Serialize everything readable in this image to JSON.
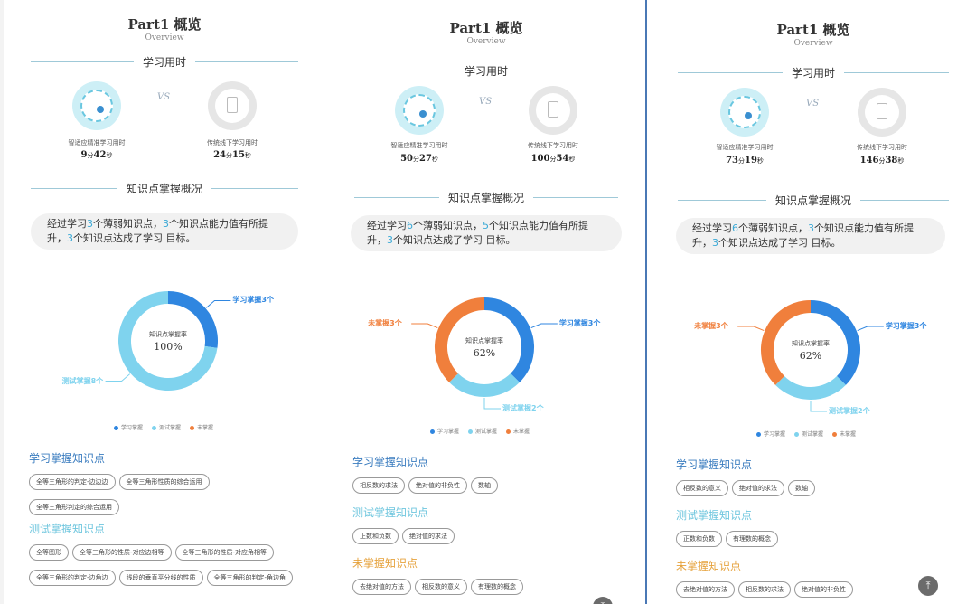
{
  "palette": {
    "blue": "#2f86e0",
    "cyan": "#7fd3ee",
    "orange": "#f07f3c",
    "tag_border": "#999999"
  },
  "legend": [
    "学习掌握",
    "测试掌握",
    "未掌握"
  ],
  "panels": [
    {
      "title": "Part1 概览",
      "subtitle": "Overview",
      "study_time_heading": "学习用时",
      "vs": "VS",
      "smart_label": "智适应精准学习用时",
      "smart_time": {
        "m": "9",
        "m_unit": "分",
        "s": "42",
        "s_unit": "秒"
      },
      "offline_label": "传统线下学习用时",
      "offline_time": {
        "m": "24",
        "m_unit": "分",
        "s": "15",
        "s_unit": "秒"
      },
      "mastery_heading": "知识点掌握概况",
      "summary": {
        "p1": "经过学习",
        "n1": "3",
        "p2": "个薄弱知识点，",
        "n2": "3",
        "p3": "个知识点能力值有所提升",
        "p4": "，",
        "n3": "3",
        "p5": "个知识点达成了学习 目标。"
      },
      "chart_data": {
        "type": "pie",
        "center_label": "知识点掌握率",
        "center_value": "100%",
        "slices": [
          {
            "name": "学习掌握",
            "label": "学习掌握3个",
            "value": 3,
            "color": "#2f86e0"
          },
          {
            "name": "测试掌握",
            "label": "测试掌握8个",
            "value": 8,
            "color": "#7fd3ee"
          }
        ]
      },
      "groups": [
        {
          "title": "学习掌握知识点",
          "color": "blue",
          "tags": [
            "全等三角形的判定-边边边",
            "全等三角形性质的综合运用",
            "全等三角形判定的综合运用"
          ]
        },
        {
          "title": "测试掌握知识点",
          "color": "cyan",
          "tags": [
            "全等图形",
            "全等三角形的性质-对应边相等",
            "全等三角形的性质-对应角相等",
            "全等三角形的判定-边角边",
            "线段的垂直平分线的性质",
            "全等三角形的判定-角边角"
          ]
        }
      ]
    },
    {
      "title": "Part1 概览",
      "subtitle": "Overview",
      "study_time_heading": "学习用时",
      "vs": "VS",
      "smart_label": "智适应精准学习用时",
      "smart_time": {
        "m": "50",
        "m_unit": "分",
        "s": "27",
        "s_unit": "秒"
      },
      "offline_label": "传统线下学习用时",
      "offline_time": {
        "m": "100",
        "m_unit": "分",
        "s": "54",
        "s_unit": "秒"
      },
      "mastery_heading": "知识点掌握概况",
      "summary": {
        "p1": "经过学习",
        "n1": "6",
        "p2": "个薄弱知识点，",
        "n2": "5",
        "p3": "个知识点能力值有所提升",
        "p4": "，",
        "n3": "3",
        "p5": "个知识点达成了学习 目标。"
      },
      "chart_data": {
        "type": "pie",
        "center_label": "知识点掌握率",
        "center_value": "62%",
        "slices": [
          {
            "name": "学习掌握",
            "label": "学习掌握3个",
            "value": 3,
            "color": "#2f86e0"
          },
          {
            "name": "测试掌握",
            "label": "测试掌握2个",
            "value": 2,
            "color": "#7fd3ee"
          },
          {
            "name": "未掌握",
            "label": "未掌握3个",
            "value": 3,
            "color": "#f07f3c"
          }
        ]
      },
      "groups": [
        {
          "title": "学习掌握知识点",
          "color": "blue",
          "tags": [
            "相反数的求法",
            "绝对值的非负性",
            "数轴"
          ]
        },
        {
          "title": "测试掌握知识点",
          "color": "cyan",
          "tags": [
            "正数和负数",
            "绝对值的求法"
          ]
        },
        {
          "title": "未掌握知识点",
          "color": "orange",
          "tags": [
            "去绝对值的方法",
            "相反数的意义",
            "有理数的概念"
          ]
        }
      ]
    },
    {
      "title": "Part1 概览",
      "subtitle": "Overview",
      "study_time_heading": "学习用时",
      "vs": "VS",
      "smart_label": "智适应精准学习用时",
      "smart_time": {
        "m": "73",
        "m_unit": "分",
        "s": "19",
        "s_unit": "秒"
      },
      "offline_label": "传统线下学习用时",
      "offline_time": {
        "m": "146",
        "m_unit": "分",
        "s": "38",
        "s_unit": "秒"
      },
      "mastery_heading": "知识点掌握概况",
      "summary": {
        "p1": "经过学习",
        "n1": "6",
        "p2": "个薄弱知识点，",
        "n2": "3",
        "p3": "个知识点能力值有所提升",
        "p4": "，",
        "n3": "3",
        "p5": "个知识点达成了学习 目标。"
      },
      "chart_data": {
        "type": "pie",
        "center_label": "知识点掌握率",
        "center_value": "62%",
        "slices": [
          {
            "name": "学习掌握",
            "label": "学习掌握3个",
            "value": 3,
            "color": "#2f86e0"
          },
          {
            "name": "测试掌握",
            "label": "测试掌握2个",
            "value": 2,
            "color": "#7fd3ee"
          },
          {
            "name": "未掌握",
            "label": "未掌握3个",
            "value": 3,
            "color": "#f07f3c"
          }
        ]
      },
      "groups": [
        {
          "title": "学习掌握知识点",
          "color": "blue",
          "tags": [
            "相反数的意义",
            "绝对值的求法",
            "数轴"
          ]
        },
        {
          "title": "测试掌握知识点",
          "color": "cyan",
          "tags": [
            "正数和负数",
            "有理数的概念"
          ]
        },
        {
          "title": "未掌握知识点",
          "color": "orange",
          "tags": [
            "去绝对值的方法",
            "相反数的求法",
            "绝对值的非负性"
          ]
        }
      ]
    }
  ],
  "back_to_top_icon": "arrow-up-to-line-icon",
  "back_to_top_glyph": "⤒"
}
